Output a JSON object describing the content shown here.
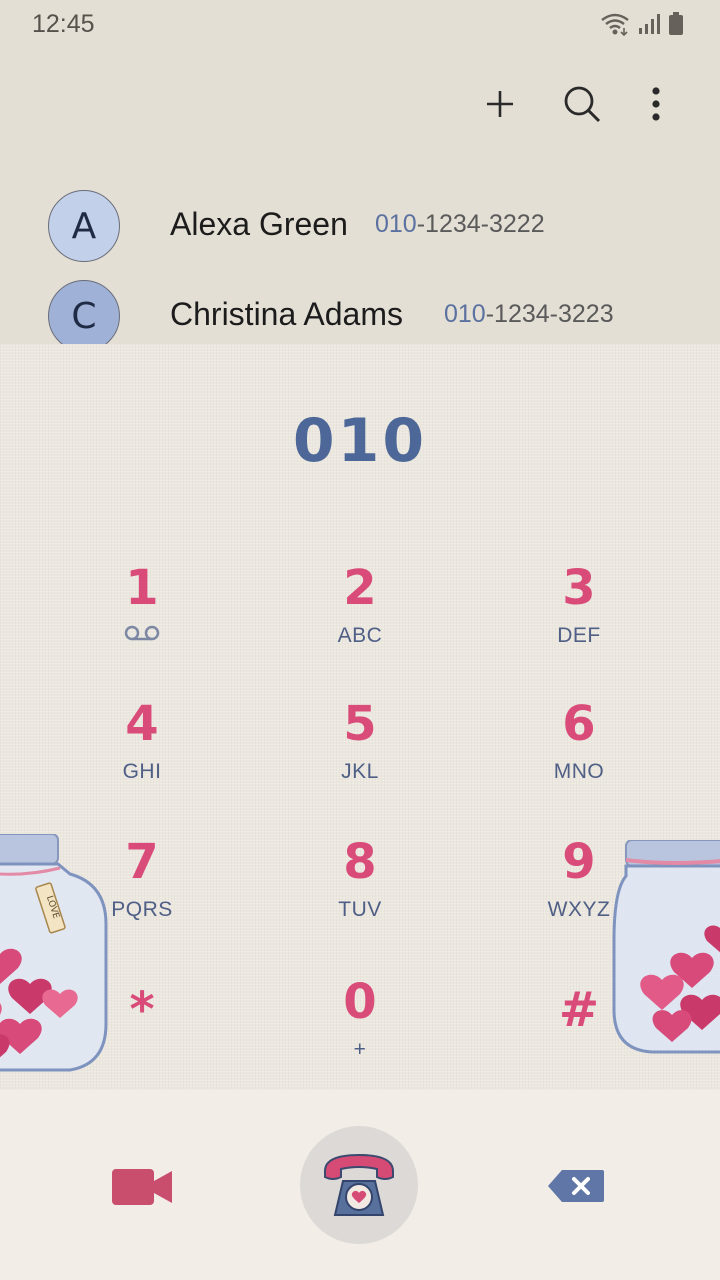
{
  "status_bar": {
    "time": "12:45",
    "icons": [
      "wifi-icon",
      "signal-icon",
      "battery-icon"
    ]
  },
  "toolbar": {
    "buttons": [
      {
        "name": "add-contact-button",
        "icon": "plus-icon"
      },
      {
        "name": "search-button",
        "icon": "search-icon"
      },
      {
        "name": "more-options-button",
        "icon": "more-vertical-icon"
      }
    ]
  },
  "contacts": [
    {
      "initial": "A",
      "name": "Alexa Green",
      "phone_match": "010",
      "phone_rest": "-1234-3222",
      "avatar_color": "#c3d0ea"
    },
    {
      "initial": "C",
      "name": "Christina Adams",
      "phone_match": "010",
      "phone_rest": "-1234-3223",
      "avatar_color": "#9fb1d6"
    }
  ],
  "dialer": {
    "entered_number": "010",
    "keys": [
      {
        "digit": "1",
        "letters": "",
        "icon": "voicemail-icon"
      },
      {
        "digit": "2",
        "letters": "ABC"
      },
      {
        "digit": "3",
        "letters": "DEF"
      },
      {
        "digit": "4",
        "letters": "GHI"
      },
      {
        "digit": "5",
        "letters": "JKL"
      },
      {
        "digit": "6",
        "letters": "MNO"
      },
      {
        "digit": "7",
        "letters": "PQRS"
      },
      {
        "digit": "8",
        "letters": "TUV"
      },
      {
        "digit": "9",
        "letters": "WXYZ"
      },
      {
        "digit": "*",
        "letters": ""
      },
      {
        "digit": "0",
        "letters": "+"
      },
      {
        "digit": "#",
        "letters": ""
      }
    ],
    "jar_tag": "LOVE"
  },
  "bottom_bar": {
    "video_icon": "video-call-icon",
    "call_icon": "telephone-icon",
    "backspace_icon": "backspace-icon"
  },
  "colors": {
    "digit": "#d94c79",
    "letters": "#4f5f86",
    "number": "#4d6898",
    "background": "#e4dfd5"
  }
}
